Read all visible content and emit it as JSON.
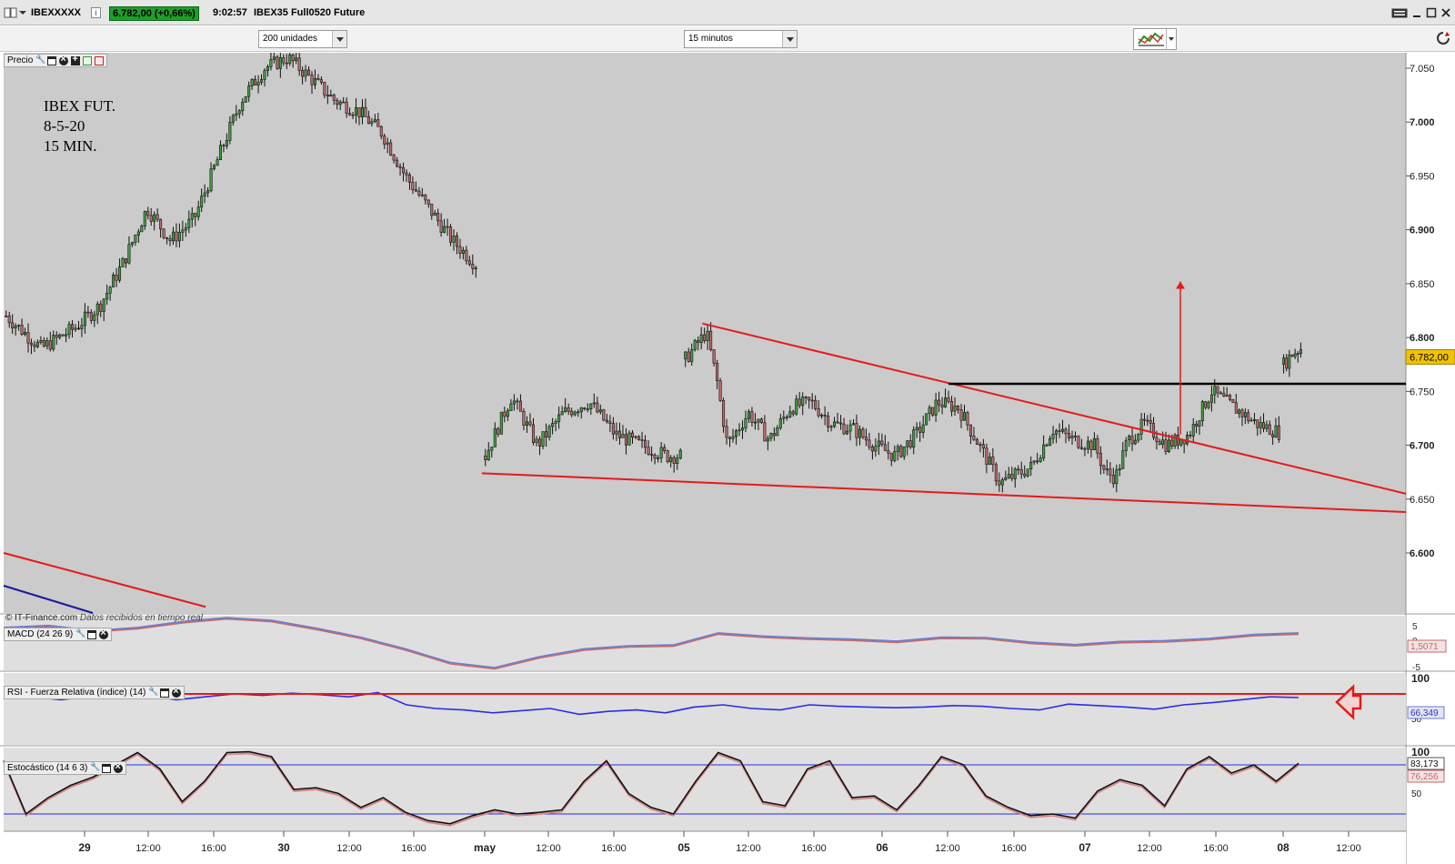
{
  "titlebar": {
    "ticker": "IBEXXXXX",
    "info": "i",
    "price_badge": "6.782,00 (+0,66%)",
    "clock": "9:02:57",
    "instrument": "IBEX35 Full0520 Future"
  },
  "toolbar": {
    "units_select": "200 unidades",
    "interval_select": "15 minutos"
  },
  "panels": {
    "price": {
      "label": "Precio"
    },
    "macd": {
      "label": "MACD (24 26 9)"
    },
    "rsi": {
      "label": "RSI - Fuerza Relativa (índice) (14)"
    },
    "stoch": {
      "label": "Estocástico (14 6 3)"
    }
  },
  "annotation": {
    "line1": "IBEX FUT.",
    "line2": "8-5-20",
    "line3": "15 MIN."
  },
  "credit": {
    "source": "© IT-Finance.com",
    "note": "Datos recibidos en tiempo real"
  },
  "colors": {
    "chart_bg": "#cbcbcb",
    "bull": "#3da53d",
    "bear": "#c46a6a",
    "trendline": "#e31b1b",
    "resistance": "#000000",
    "last_price_bg": "#f2c200",
    "macd_bg": "#dfdfdf"
  },
  "chart_data": [
    {
      "type": "candlestick",
      "series": [
        {
          "name": "IBEX35 Full0520 Future"
        }
      ],
      "last_price": 6782,
      "last_price_label": "6.782,00",
      "ylim": [
        6550,
        7070
      ],
      "yticks": [
        6600,
        6650,
        6700,
        6750,
        6800,
        6850,
        6900,
        6950,
        7000,
        7050
      ],
      "ytick_labels": [
        "6.600",
        "6.650",
        "6.700",
        "6.750",
        "6.800",
        "6.850",
        "6.900",
        "6.950",
        "7.000",
        "7.050"
      ],
      "x_labels": [
        "29",
        "12:00",
        "16:00",
        "30",
        "12:00",
        "16:00",
        "may",
        "12:00",
        "16:00",
        "05",
        "12:00",
        "16:00",
        "06",
        "12:00",
        "16:00",
        "07",
        "12:00",
        "16:00",
        "08",
        "12:00"
      ],
      "x_bold": [
        "29",
        "30",
        "may",
        "05",
        "06",
        "07",
        "08"
      ],
      "resistance_level": 6757,
      "price_path": [
        [
          0,
          6820
        ],
        [
          0.03,
          6790
        ],
        [
          0.06,
          6810
        ],
        [
          0.08,
          6830
        ],
        [
          0.1,
          6870
        ],
        [
          0.12,
          6920
        ],
        [
          0.14,
          6890
        ],
        [
          0.16,
          6910
        ],
        [
          0.18,
          6965
        ],
        [
          0.2,
          7020
        ],
        [
          0.22,
          7050
        ],
        [
          0.24,
          7060
        ],
        [
          0.26,
          7040
        ],
        [
          0.28,
          7020
        ],
        [
          0.3,
          7010
        ],
        [
          0.32,
          6990
        ],
        [
          0.34,
          6950
        ],
        [
          0.36,
          6920
        ],
        [
          0.38,
          6890
        ],
        [
          0.4,
          6868
        ],
        [
          0.41,
          6690
        ],
        [
          0.43,
          6745
        ],
        [
          0.45,
          6700
        ],
        [
          0.47,
          6730
        ],
        [
          0.49,
          6740
        ],
        [
          0.51,
          6710
        ],
        [
          0.53,
          6700
        ],
        [
          0.55,
          6690
        ],
        [
          0.56,
          6690
        ],
        [
          0.57,
          6780
        ],
        [
          0.59,
          6805
        ],
        [
          0.6,
          6760
        ],
        [
          0.61,
          6700
        ],
        [
          0.63,
          6730
        ],
        [
          0.65,
          6705
        ],
        [
          0.67,
          6735
        ],
        [
          0.69,
          6740
        ],
        [
          0.71,
          6720
        ],
        [
          0.73,
          6715
        ],
        [
          0.75,
          6700
        ],
        [
          0.77,
          6690
        ],
        [
          0.79,
          6710
        ],
        [
          0.81,
          6740
        ],
        [
          0.83,
          6735
        ],
        [
          0.85,
          6700
        ],
        [
          0.87,
          6665
        ],
        [
          0.88,
          6670
        ],
        [
          0.9,
          6680
        ],
        [
          0.92,
          6715
        ],
        [
          0.94,
          6705
        ],
        [
          0.96,
          6700
        ],
        [
          0.97,
          6675
        ],
        [
          0.98,
          6670
        ],
        [
          0.99,
          6700
        ]
      ],
      "price_path_tail": [
        [
          0,
          6705
        ],
        [
          0.1,
          6720
        ],
        [
          0.25,
          6700
        ],
        [
          0.4,
          6710
        ],
        [
          0.55,
          6750
        ],
        [
          0.7,
          6735
        ],
        [
          0.85,
          6720
        ],
        [
          1,
          6712
        ]
      ],
      "after_gap": [
        [
          0,
          6775
        ],
        [
          0.5,
          6785
        ],
        [
          1,
          6790
        ]
      ],
      "trendlines": [
        {
          "name": "upper",
          "from": [
            0.4983,
            6813
          ],
          "to": [
            1.0,
            6655
          ]
        },
        {
          "name": "lower",
          "from": [
            0.341,
            6674
          ],
          "to": [
            1.0,
            6638
          ]
        },
        {
          "name": "old",
          "from": [
            0.0,
            6600
          ],
          "to": [
            0.144,
            6550
          ]
        }
      ],
      "breakout_arrow": {
        "from": 6710,
        "to": 6852
      }
    },
    {
      "type": "line",
      "name_label": "MACD (24 26 9)",
      "yticks_labels": [
        "5",
        "0",
        "-5"
      ],
      "last_value": "1,5071",
      "values": [
        3,
        3.5,
        2.2,
        3.0,
        4.5,
        5.5,
        4.8,
        2.8,
        0.5,
        -2.5,
        -6,
        -7.3,
        -4.5,
        -2.5,
        -1.7,
        -1.5,
        1.6,
        0.8,
        0.3,
        0.0,
        -0.5,
        0.5,
        0.4,
        -0.8,
        -1.4,
        -0.6,
        -0.4,
        0.2,
        1.2,
        1.6
      ]
    },
    {
      "type": "line",
      "name_label": "RSI - Fuerza Relativa (índice) (14)",
      "yticks_labels": [
        "100",
        "50"
      ],
      "last_value": "66,349",
      "level_line": 70,
      "values": [
        65,
        66,
        62,
        67,
        64,
        68,
        62,
        66,
        70,
        68,
        71,
        69,
        66,
        72,
        55,
        50,
        48,
        44,
        47,
        50,
        42,
        46,
        48,
        44,
        52,
        55,
        50,
        48,
        55,
        53,
        52,
        51,
        52,
        54,
        53,
        50,
        48,
        56,
        54,
        52,
        49,
        55,
        58,
        62,
        66,
        65
      ]
    },
    {
      "type": "line",
      "name_label": "Estocástico (14 6 3)",
      "yticks_labels": [
        "100",
        "50"
      ],
      "last_values": [
        "83,173",
        "76,256"
      ],
      "upper_level": 80,
      "lower_level": 20,
      "values": [
        85,
        20,
        40,
        55,
        65,
        80,
        95,
        75,
        35,
        60,
        95,
        96,
        90,
        50,
        52,
        45,
        28,
        40,
        22,
        12,
        8,
        18,
        25,
        20,
        22,
        25,
        60,
        85,
        45,
        28,
        20,
        60,
        95,
        85,
        35,
        30,
        75,
        85,
        40,
        42,
        25,
        55,
        90,
        80,
        42,
        28,
        18,
        20,
        15,
        48,
        62,
        55,
        30,
        75,
        90,
        70,
        80,
        60,
        82
      ]
    }
  ]
}
